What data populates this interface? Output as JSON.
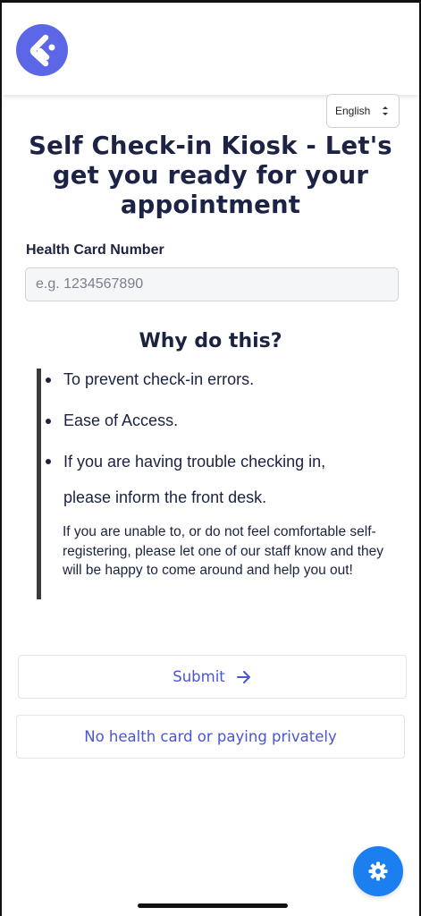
{
  "header": {
    "logo_icon": "app-logo-icon",
    "brand_color": "#5b67e6"
  },
  "language": {
    "selected": "English",
    "icon": "sort-arrows-icon"
  },
  "page": {
    "title": "Self Check-in Kiosk - Let's get you ready for your appointment"
  },
  "health_card": {
    "label": "Health Card Number",
    "placeholder": "e.g. 1234567890",
    "value": ""
  },
  "why": {
    "heading": "Why do this?",
    "bullets": [
      "To prevent check-in errors.",
      "Ease of Access.",
      "If you are having trouble checking in, please inform the front desk."
    ],
    "note": "If you are unable to, or do not feel comfortable self-registering, please let one of our staff know and they will be happy to come around and help you out!"
  },
  "actions": {
    "submit_label": "Submit",
    "submit_icon": "arrow-right-icon",
    "private_label": "No health card or paying privately",
    "accent_color": "#4a55d6"
  },
  "settings": {
    "icon": "gear-icon",
    "color": "#1b7ff0"
  }
}
